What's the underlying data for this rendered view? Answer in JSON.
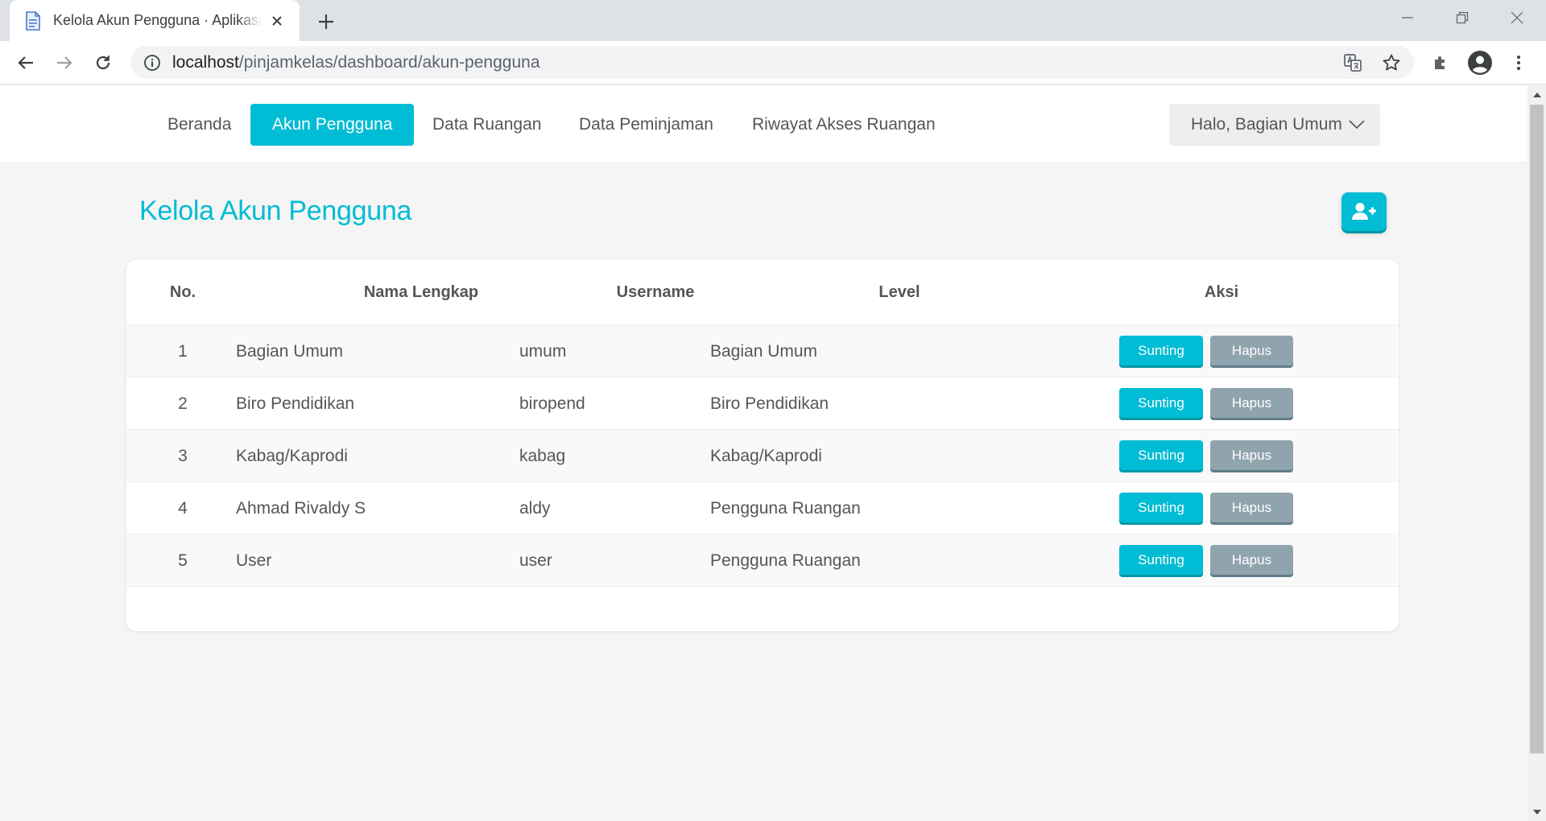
{
  "browser": {
    "tab_title": "Kelola Akun Pengguna · Aplikasi Peminjaman Ruang Kelas",
    "url_host": "localhost",
    "url_path": "/pinjamkelas/dashboard/akun-pengguna"
  },
  "navbar": {
    "items": [
      {
        "label": "Beranda",
        "active": false
      },
      {
        "label": "Akun Pengguna",
        "active": true
      },
      {
        "label": "Data Ruangan",
        "active": false
      },
      {
        "label": "Data Peminjaman",
        "active": false
      },
      {
        "label": "Riwayat Akses Ruangan",
        "active": false
      }
    ],
    "user_menu": "Halo, Bagian Umum"
  },
  "page": {
    "title": "Kelola Akun Pengguna",
    "add_user_icon": "user-plus-icon"
  },
  "table": {
    "headers": {
      "no": "No.",
      "name": "Nama Lengkap",
      "username": "Username",
      "level": "Level",
      "action": "Aksi"
    },
    "rows": [
      {
        "no": "1",
        "name": "Bagian Umum",
        "username": "umum",
        "level": "Bagian Umum"
      },
      {
        "no": "2",
        "name": "Biro Pendidikan",
        "username": "biropend",
        "level": "Biro Pendidikan"
      },
      {
        "no": "3",
        "name": "Kabag/Kaprodi",
        "username": "kabag",
        "level": "Kabag/Kaprodi"
      },
      {
        "no": "4",
        "name": "Ahmad Rivaldy S",
        "username": "aldy",
        "level": "Pengguna Ruangan"
      },
      {
        "no": "5",
        "name": "User",
        "username": "user",
        "level": "Pengguna Ruangan"
      }
    ],
    "edit_label": "Sunting",
    "delete_label": "Hapus"
  },
  "colors": {
    "accent": "#00bcd4",
    "delete": "#90a4ae"
  }
}
